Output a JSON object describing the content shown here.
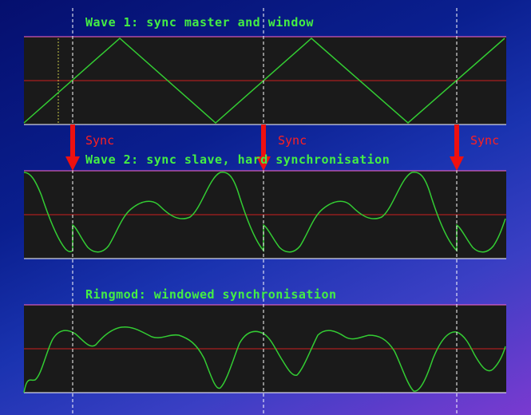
{
  "panels": [
    {
      "id": "wave1",
      "title": "Wave 1: sync master and window"
    },
    {
      "id": "wave2",
      "title": "Wave 2: sync slave, hard synchronisation"
    },
    {
      "id": "ringmod",
      "title": "Ringmod: windowed synchronisation"
    }
  ],
  "sync": {
    "label": "Sync",
    "count": 3
  },
  "colors": {
    "wave": "#33cc33",
    "title": "#44ee44",
    "midline": "#cc2020",
    "panel_bg": "#1a1a1a",
    "panel_border": "#ff66cc",
    "sync_arrow": "#ee1010",
    "sync_text": "#ff2020",
    "divider": "#ffffff"
  }
}
